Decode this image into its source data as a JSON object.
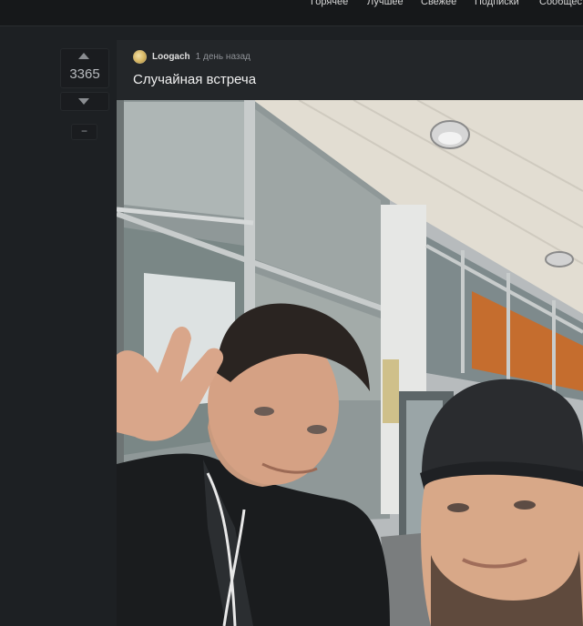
{
  "nav": {
    "items": [
      "Горячее",
      "Лучшее",
      "Свежее",
      "Подписки",
      "Сообщества"
    ]
  },
  "vote": {
    "count": "3365",
    "minus_label": "−"
  },
  "post": {
    "author": "Loogach",
    "time": "1 день назад",
    "title": "Случайная встреча"
  },
  "colors": {
    "background": "#1d2023",
    "card": "#232629",
    "text": "#e8e8e8",
    "muted": "#8e9196"
  },
  "icons": [
    "arrow-up-icon",
    "arrow-down-icon",
    "minus-icon"
  ]
}
